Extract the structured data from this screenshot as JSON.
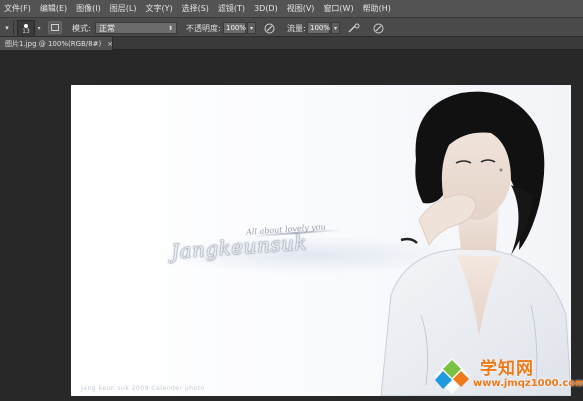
{
  "menubar": {
    "items": [
      {
        "label": "文件(F)"
      },
      {
        "label": "编辑(E)"
      },
      {
        "label": "图像(I)"
      },
      {
        "label": "图层(L)"
      },
      {
        "label": "文字(Y)"
      },
      {
        "label": "选择(S)"
      },
      {
        "label": "滤镜(T)"
      },
      {
        "label": "3D(D)"
      },
      {
        "label": "视图(V)"
      },
      {
        "label": "窗口(W)"
      },
      {
        "label": "帮助(H)"
      }
    ]
  },
  "options": {
    "tool_preset_arrow": "▾",
    "brush_size": "13",
    "brush_arrow": "▾",
    "mode_label": "模式:",
    "mode_value": "正常",
    "mode_arrow": "⬍",
    "opacity_label": "不透明度:",
    "opacity_value": "100%",
    "opacity_arrow": "▾",
    "flow_label": "流量:",
    "flow_value": "100%",
    "flow_arrow": "▾",
    "icons": [
      "panel-toggle-icon",
      "pressure-opacity-icon",
      "airbrush-icon",
      "pressure-size-icon"
    ]
  },
  "document": {
    "tab_title": "图片1.jpg @ 100%(RGB/8#)",
    "close": "×"
  },
  "canvas": {
    "signature": "Jangkeunsuk",
    "small_signature": "All about lovely you",
    "bottom_caption": "Jang keun suk  2009  Calender  photo"
  },
  "watermark": {
    "title": "学知网",
    "url": "www.jmqz1000.com",
    "colors": {
      "orange": "#f07a1a",
      "blue": "#1e9be0",
      "green": "#7cc242"
    }
  }
}
